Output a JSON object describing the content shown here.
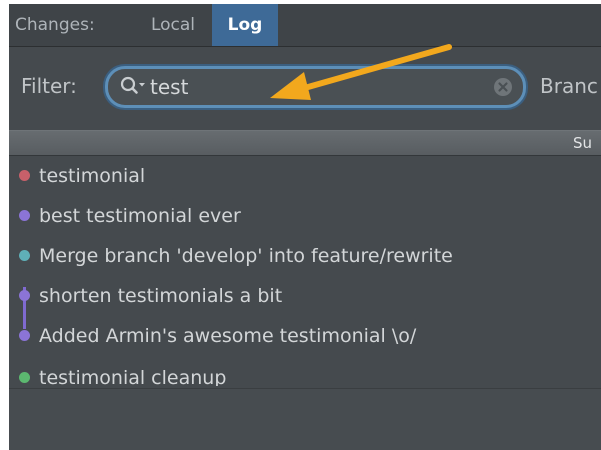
{
  "tabs": {
    "changes_label": "Changes:",
    "local_label": "Local",
    "log_label": "Log"
  },
  "filter": {
    "label": "Filter:",
    "value": "test",
    "branch_label": "Branc"
  },
  "column_header": {
    "subject_label": "Su"
  },
  "commits": [
    {
      "message": "testimonial",
      "color": "#c7606a"
    },
    {
      "message": "best testimonial ever",
      "color": "#8b74d6"
    },
    {
      "message": "Merge branch 'develop' into feature/rewrite",
      "color": "#5fb0b8"
    },
    {
      "message": "shorten testimonials a bit",
      "color": "#8b74d6"
    },
    {
      "message": "Added Armin's awesome testimonial \\o/",
      "color": "#8b74d6"
    },
    {
      "message": "testimonial cleanup",
      "color": "#5cb870"
    }
  ],
  "colors": {
    "panel_bg": "#454a4e",
    "selected_tab": "#3e6a97",
    "search_focus": "#5d8fb8",
    "annotation_arrow": "#f2a81d"
  },
  "icons": {
    "search": "search-icon",
    "clear": "clear-icon",
    "annotation": "arrow-annotation-icon"
  }
}
